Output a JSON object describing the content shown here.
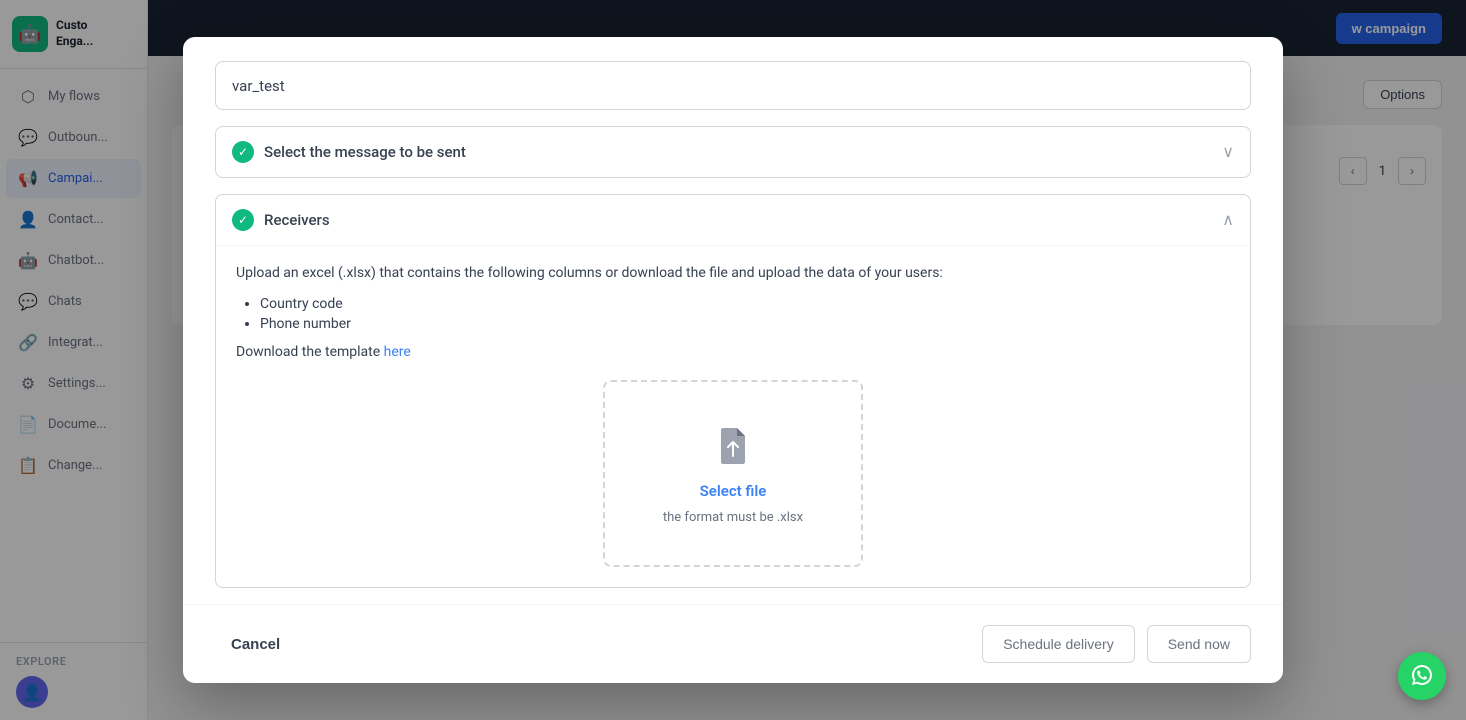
{
  "sidebar": {
    "logo_text": "Custom\nEngage",
    "nav_items": [
      {
        "id": "my-flows",
        "label": "My flows",
        "icon": "⬡"
      },
      {
        "id": "outbound",
        "label": "Outboun...",
        "icon": "💬"
      },
      {
        "id": "campaigns",
        "label": "Campai...",
        "icon": "📢",
        "active": true
      },
      {
        "id": "contacts",
        "label": "Contact...",
        "icon": "👤"
      },
      {
        "id": "chatbots",
        "label": "Chatbot...",
        "icon": "🤖"
      },
      {
        "id": "chats",
        "label": "Chats",
        "icon": "💬"
      },
      {
        "id": "integrations",
        "label": "Integrat...",
        "icon": "🔗"
      },
      {
        "id": "settings",
        "label": "Settings...",
        "icon": "⚙"
      },
      {
        "id": "documents",
        "label": "Docume...",
        "icon": "📄"
      },
      {
        "id": "changelog",
        "label": "Change...",
        "icon": "📋"
      }
    ],
    "explore_label": "Explore"
  },
  "topbar": {
    "new_campaign_label": "w campaign"
  },
  "options_btn_label": "Options",
  "pagination": {
    "page": "1",
    "prev_icon": "‹",
    "next_icon": "›"
  },
  "modal": {
    "name_field_value": "var_test",
    "select_message_section": {
      "title": "Select the message to be sent",
      "is_checked": true,
      "expanded": false
    },
    "receivers_section": {
      "title": "Receivers",
      "is_checked": true,
      "expanded": true,
      "description": "Upload an excel (.xlsx) that contains the following columns or download the file and upload the data of your users:",
      "bullet_items": [
        "Country code",
        "Phone number"
      ],
      "download_text": "Download the template ",
      "download_link_text": "here",
      "file_upload": {
        "select_file_label": "Select file",
        "format_hint": "the format must be .xlsx"
      }
    },
    "footer": {
      "cancel_label": "Cancel",
      "schedule_label": "Schedule delivery",
      "send_now_label": "Send now"
    }
  }
}
